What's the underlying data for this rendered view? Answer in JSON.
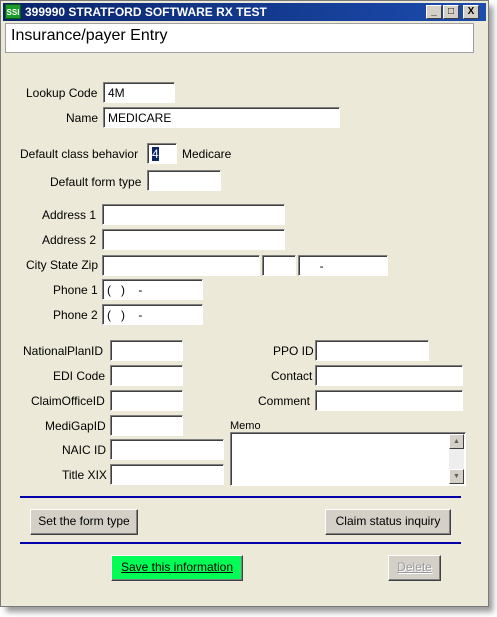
{
  "window": {
    "title": "399990 STRATFORD SOFTWARE RX TEST",
    "icon_label": "SSI",
    "minimize_glyph": "_",
    "maximize_glyph": "□",
    "close_glyph": "X"
  },
  "header": {
    "title": "Insurance/payer Entry"
  },
  "form": {
    "lookup_code": {
      "label": "Lookup Code",
      "value": "4M"
    },
    "name": {
      "label": "Name",
      "value": "MEDICARE"
    },
    "default_class_behavior": {
      "label": "Default class behavior",
      "value": "4",
      "description": "Medicare"
    },
    "default_form_type": {
      "label": "Default form type",
      "value": ""
    },
    "address1": {
      "label": "Address 1",
      "value": ""
    },
    "address2": {
      "label": "Address 2",
      "value": ""
    },
    "city_state_zip": {
      "label": "City State  Zip",
      "city": "",
      "state": "",
      "zip": "     -"
    },
    "phone1": {
      "label": "Phone 1",
      "value": "(   )    -"
    },
    "phone2": {
      "label": "Phone 2",
      "value": "(   )    -"
    },
    "national_plan_id": {
      "label": "NationalPlanID",
      "value": ""
    },
    "edi_code": {
      "label": "EDI Code",
      "value": ""
    },
    "claim_office_id": {
      "label": "ClaimOfficeID",
      "value": ""
    },
    "medigap_id": {
      "label": "MediGapID",
      "value": ""
    },
    "naic_id": {
      "label": "NAIC ID",
      "value": ""
    },
    "title_xix": {
      "label": "Title XIX",
      "value": ""
    },
    "ppo_id": {
      "label": "PPO ID",
      "value": ""
    },
    "contact": {
      "label": "Contact",
      "value": ""
    },
    "comment": {
      "label": "Comment",
      "value": ""
    },
    "memo": {
      "label": "Memo",
      "value": ""
    }
  },
  "buttons": {
    "set_form_type": "Set the form type",
    "claim_status": "Claim status inquiry",
    "save": "Save this information",
    "delete": "Delete"
  },
  "colors": {
    "titlebar": "#0a246a",
    "save_button": "#00ff55",
    "separator": "#0000aa"
  }
}
